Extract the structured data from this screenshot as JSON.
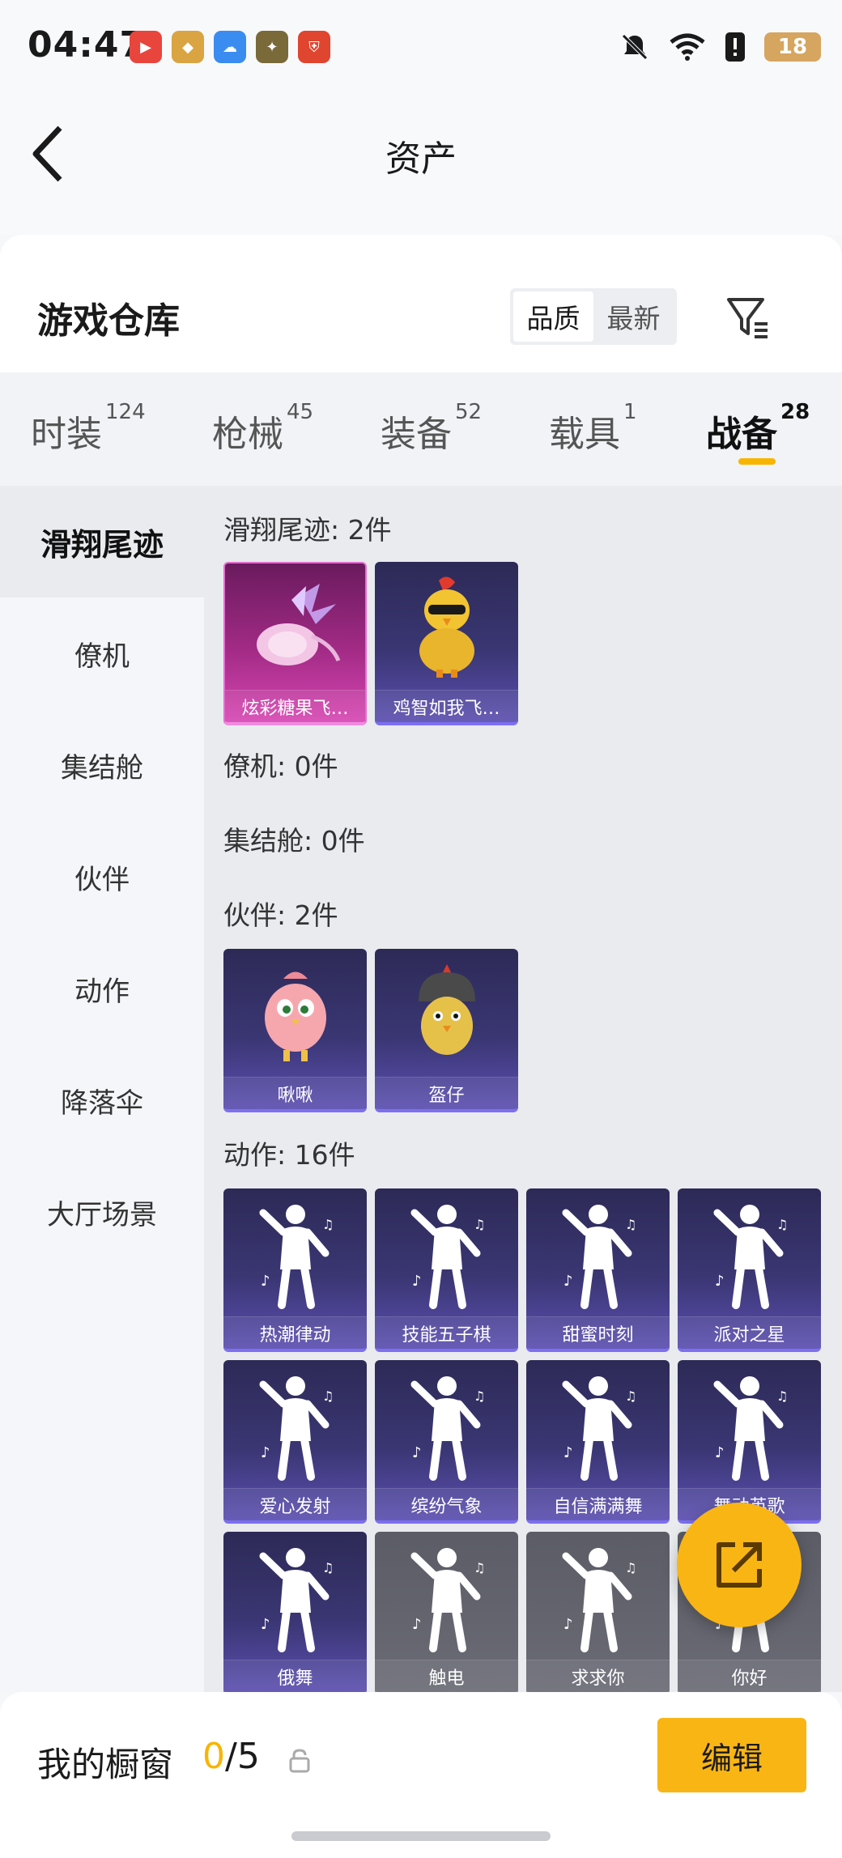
{
  "status": {
    "time": "04:47",
    "battery": "18"
  },
  "header": {
    "title": "资产"
  },
  "warehouse": {
    "title": "游戏仓库",
    "sort_options": [
      "品质",
      "最新"
    ],
    "sort_active": "品质"
  },
  "tabs": [
    {
      "label": "时装",
      "count": "124"
    },
    {
      "label": "枪械",
      "count": "45"
    },
    {
      "label": "装备",
      "count": "52"
    },
    {
      "label": "载具",
      "count": "1"
    },
    {
      "label": "战备",
      "count": "28"
    }
  ],
  "sidebar": [
    "滑翔尾迹",
    "僚机",
    "集结舱",
    "伙伴",
    "动作",
    "降落伞",
    "大厅场景"
  ],
  "sections": {
    "glide": {
      "title": "滑翔尾迹: 2件",
      "items": [
        "炫彩糖果飞…",
        "鸡智如我飞…"
      ]
    },
    "wingman": {
      "title": "僚机: 0件"
    },
    "pod": {
      "title": "集结舱: 0件"
    },
    "partner": {
      "title": "伙伴: 2件",
      "items": [
        "啾啾",
        "盔仔"
      ]
    },
    "emote": {
      "title": "动作: 16件",
      "items": [
        "热潮律动",
        "技能五子棋",
        "甜蜜时刻",
        "派对之星",
        "爱心发射",
        "缤纷气象",
        "自信满满舞",
        "舞动英歌",
        "俄舞",
        "触电",
        "求求你",
        "你好"
      ]
    }
  },
  "bottom": {
    "showcase_label": "我的橱窗",
    "current": "0",
    "total": "/5",
    "edit_label": "编辑"
  }
}
